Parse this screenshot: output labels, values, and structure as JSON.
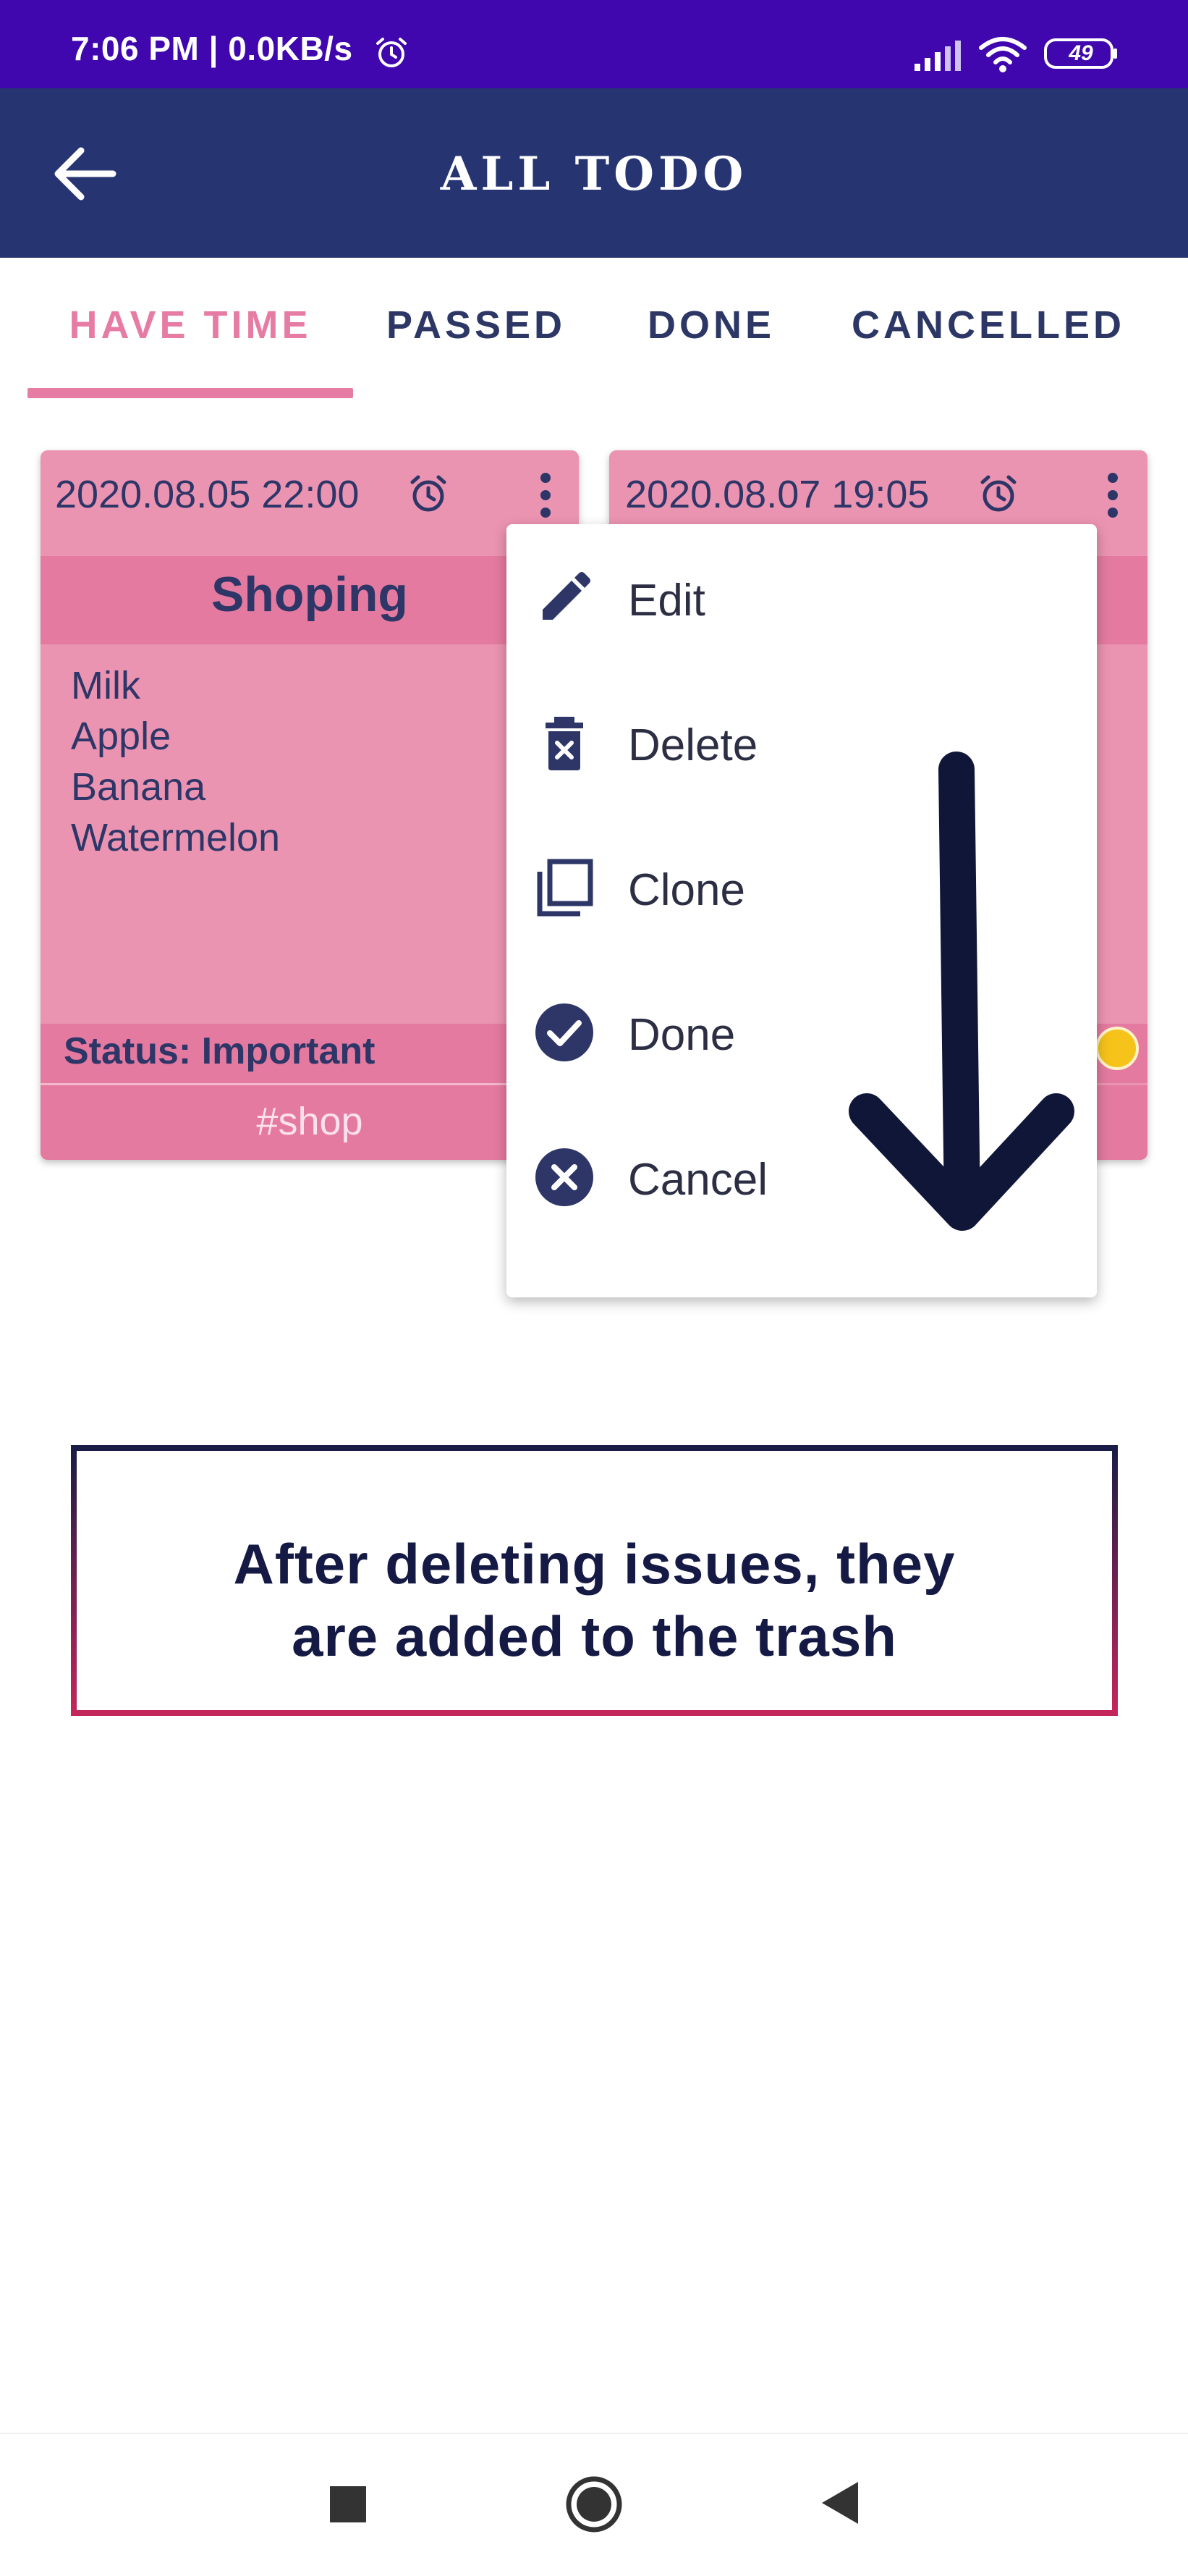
{
  "status_bar": {
    "time": "7:06 PM | 0.0KB/s",
    "alarm_icon": "alarm-clock-icon",
    "signal_icon": "signal-icon",
    "wifi_icon": "wifi-icon",
    "battery": "49"
  },
  "app_bar": {
    "title": "ALL TODO",
    "back_icon": "arrow-left-icon"
  },
  "tabs": [
    {
      "label": "HAVE TIME",
      "active": true
    },
    {
      "label": "PASSED",
      "active": false
    },
    {
      "label": "DONE",
      "active": false
    },
    {
      "label": "CANCELLED",
      "active": false
    }
  ],
  "cards": [
    {
      "date": "2020.08.05 22:00",
      "title": "Shoping",
      "items": [
        "Milk",
        "Apple",
        "Banana",
        "Watermelon"
      ],
      "status": "Status: Important",
      "tag": "#shop"
    },
    {
      "date": "2020.08.07 19:05",
      "status_dot_color": "#f5c31a"
    }
  ],
  "menu": {
    "items": [
      {
        "label": "Edit",
        "icon": "pencil-icon"
      },
      {
        "label": "Delete",
        "icon": "trash-icon"
      },
      {
        "label": "Clone",
        "icon": "copy-icon"
      },
      {
        "label": "Done",
        "icon": "check-circle-icon"
      },
      {
        "label": "Cancel",
        "icon": "x-circle-icon"
      }
    ]
  },
  "caption": {
    "line1": "After deleting issues, they",
    "line2": "are added to the trash"
  },
  "nav_bar": {
    "recents_icon": "square-icon",
    "home_icon": "circle-home-icon",
    "back_icon": "triangle-back-icon"
  },
  "colors": {
    "status_bar": "#3f07ad",
    "app_bar": "#263571",
    "accent_pink": "#e67ca4",
    "card_pink": "#eb94b2",
    "navy": "#2d3667"
  }
}
